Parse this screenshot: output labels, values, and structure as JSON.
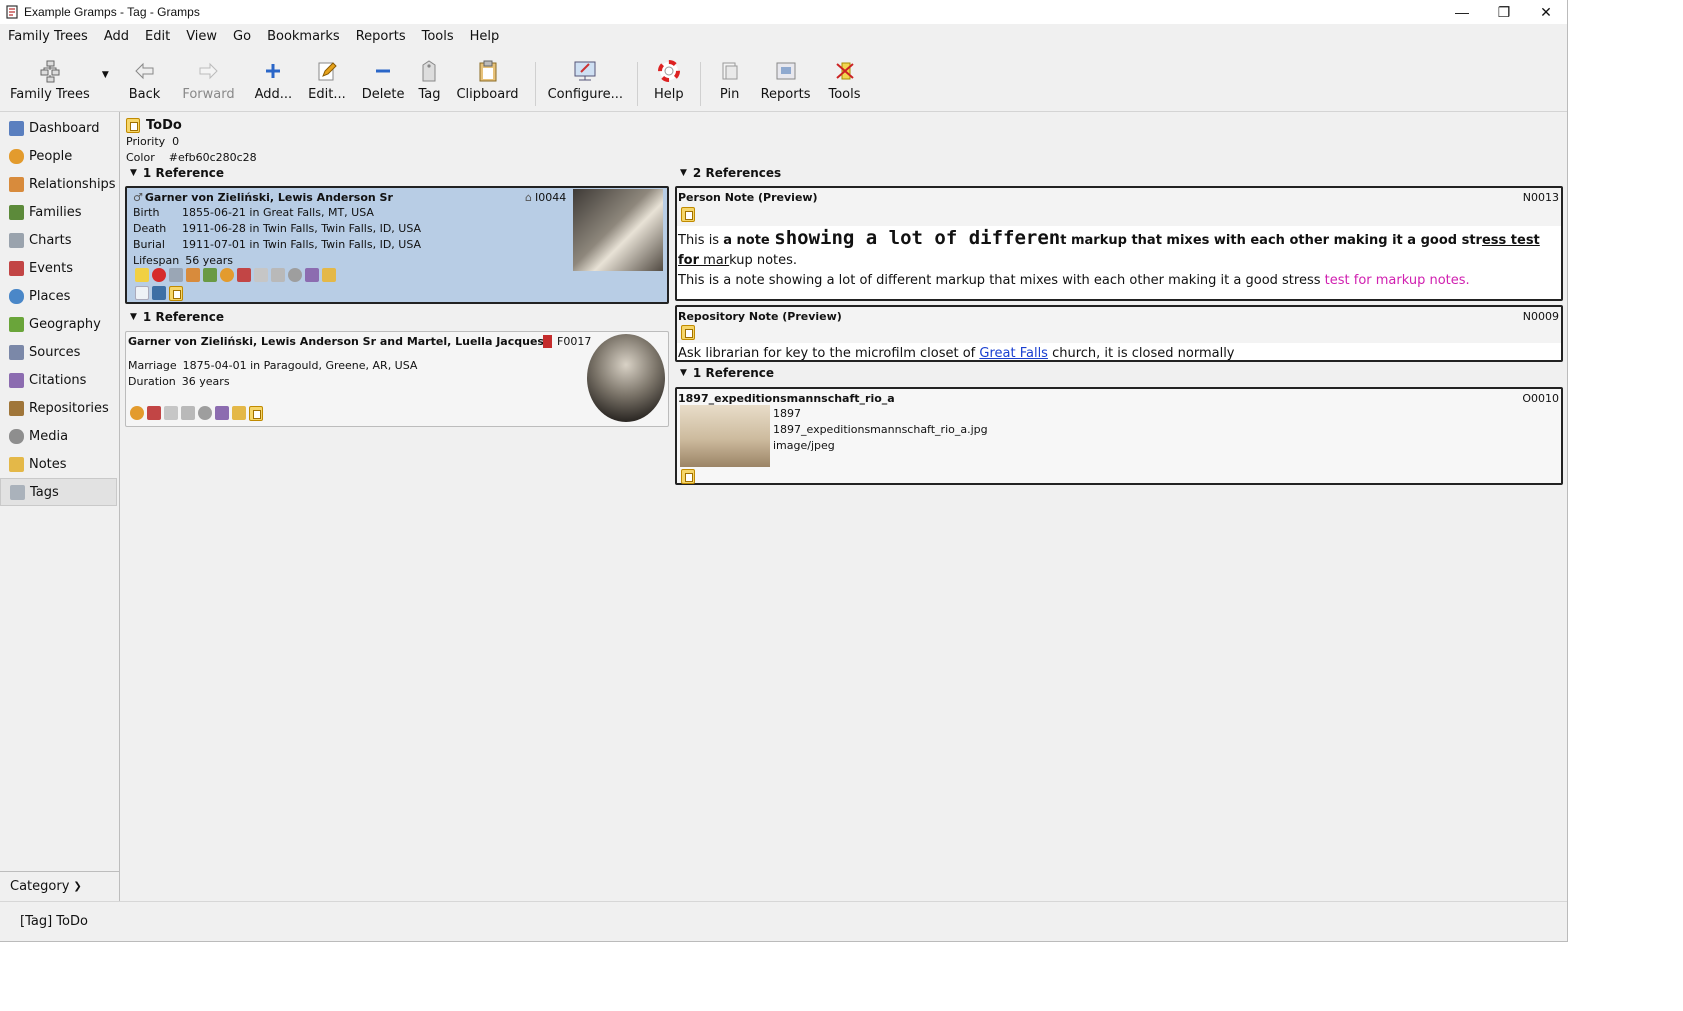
{
  "window": {
    "title": "Example Gramps - Tag - Gramps"
  },
  "menu": [
    "Family Trees",
    "Add",
    "Edit",
    "View",
    "Go",
    "Bookmarks",
    "Reports",
    "Tools",
    "Help"
  ],
  "toolbar": {
    "family_trees": "Family Trees",
    "back": "Back",
    "forward": "Forward",
    "add": "Add...",
    "edit": "Edit...",
    "delete": "Delete",
    "tag": "Tag",
    "clipboard": "Clipboard",
    "configure": "Configure...",
    "help": "Help",
    "pin": "Pin",
    "reports": "Reports",
    "tools": "Tools"
  },
  "sidebar": {
    "items": [
      "Dashboard",
      "People",
      "Relationships",
      "Families",
      "Charts",
      "Events",
      "Places",
      "Geography",
      "Sources",
      "Citations",
      "Repositories",
      "Media",
      "Notes",
      "Tags"
    ],
    "category": "Category"
  },
  "tag": {
    "name": "ToDo",
    "priority_label": "Priority",
    "priority": "0",
    "color_label": "Color",
    "color": "#efb60c280c28"
  },
  "left": {
    "person_section": "1 Reference",
    "person": {
      "name": "Garner von Zieliński, Lewis Anderson Sr",
      "id": "I0044",
      "birth_label": "Birth",
      "birth": "1855-06-21 in Great Falls, MT, USA",
      "death_label": "Death",
      "death": "1911-06-28 in Twin Falls, Twin Falls, ID, USA",
      "burial_label": "Burial",
      "burial": "1911-07-01 in Twin Falls, Twin Falls, ID, USA",
      "lifespan_label": "Lifespan",
      "lifespan": "56 years"
    },
    "family_section": "1 Reference",
    "family": {
      "name": "Garner von Zieliński, Lewis Anderson Sr and Martel, Luella Jacques",
      "id": "F0017",
      "marriage_label": "Marriage",
      "marriage": "1875-04-01 in Paragould, Greene, AR, USA",
      "duration_label": "Duration",
      "duration": "36 years"
    }
  },
  "right": {
    "notes_section": "2 References",
    "person_note": {
      "title": "Person Note (Preview)",
      "id": "N0013",
      "p1_a": "This is ",
      "p1_b": "a note ",
      "p1_c": "showing a lot of differen",
      "p1_d": "t markup that mixes with each other making it a good str",
      "p1_e": "ess test",
      "p1_f": "for",
      "p1_g": " mar",
      "p1_h": "kup notes.",
      "p2_a": "This is a note showing a lot of different markup that mixes with each other making it a good stress ",
      "p2_b": "test for markup notes."
    },
    "repo_note": {
      "title": "Repository Note (Preview)",
      "id": "N0009",
      "text_a": "Ask librarian for key to the microfilm closet of ",
      "link": "Great Falls",
      "text_b": " church, it is closed normally"
    },
    "media_section": "1 Reference",
    "media": {
      "title": "1897_expeditionsmannschaft_rio_a",
      "id": "O0010",
      "date": "1897",
      "file": "1897_expeditionsmannschaft_rio_a.jpg",
      "mime": "image/jpeg"
    }
  },
  "status": "[Tag] ToDo",
  "colors": {
    "selected": "#b8cde5",
    "magenta": "#d020b0",
    "link": "#1a3fd0"
  }
}
